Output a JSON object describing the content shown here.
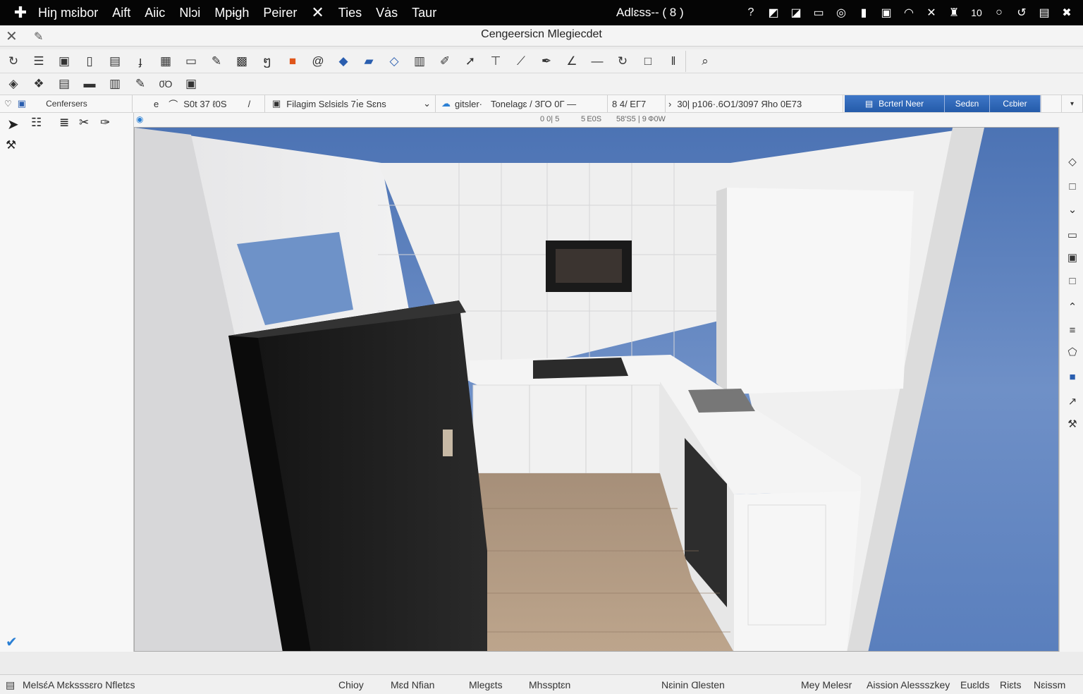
{
  "menubar": {
    "items": [
      "Hiŋ mɛibor",
      "Aift",
      "Aiic",
      "Nlɔi",
      "Mpɨgh",
      "Peirer",
      "Ties",
      "Vȧs",
      "Taur"
    ],
    "center_text": "Adlɛss-- ( 8 )",
    "clock": "10"
  },
  "window": {
    "title": "Cengeersicn Mlegiecdet"
  },
  "toolbar": {
    "row1_icons": [
      "lasso-icon",
      "list-icon",
      "frame-icon",
      "page-icon",
      "doc-icon",
      "hook-icon",
      "grid-icon",
      "window-icon",
      "brush-icon",
      "pattern-icon",
      "curl-icon",
      "orange-square-icon",
      "spiral-icon",
      "ruler-icon",
      "ruler-blue-icon",
      "ruler-diag-icon",
      "table-icon",
      "pen-icon",
      "arrow-icon",
      "crop-icon",
      "knife-icon",
      "feather-icon",
      "angle-icon",
      "line-icon",
      "rotate-icon",
      "rect-icon",
      "pause-icon",
      "zoom-icon"
    ],
    "row2_icons": [
      "erase-icon",
      "cube-icon",
      "stack-icon",
      "panel-icon",
      "book-icon",
      "pencil-icon",
      "glasses-icon",
      "image-icon"
    ],
    "row2_text": "0̈O"
  },
  "options": {
    "panel_label": "Cenfersers",
    "field1": "S0t 37 ℓ0S",
    "font_name": "Filagim Sɛlsiɛls 7ı̇e Sɛns",
    "tone_label": "gitsler·",
    "tone_value": "Tonelagɛ / ЗГО 0Г —",
    "size1": "8 4/ ЕГ7",
    "coord": "30| p106·.6О1/3097 Яhо 0Ε73",
    "btn_primary": "Bcrterl Neer",
    "btn_second": "Sedɛn",
    "btn_third": "Cɛbier"
  },
  "ruler": {
    "labels": [
      "0 0| 5",
      "5 Е0S",
      "58'S5 | 9 Ф0W"
    ]
  },
  "statusbar": {
    "left": "Melsɛ́A Mɛksssɛro Nfletɛs",
    "items": [
      "Chioy",
      "Mɛd Nfian",
      "Mlegɛts",
      "Mhssptɛn",
      "Nɛinin Ɑlesten",
      "Mey Melesr",
      "Aission Alessszkey",
      "Euɛlds",
      "Riɛts",
      "Nɛissm"
    ]
  },
  "colors": {
    "accent": "#2a5eaf",
    "menubar": "#050505",
    "sky": "#5a7fbd"
  }
}
